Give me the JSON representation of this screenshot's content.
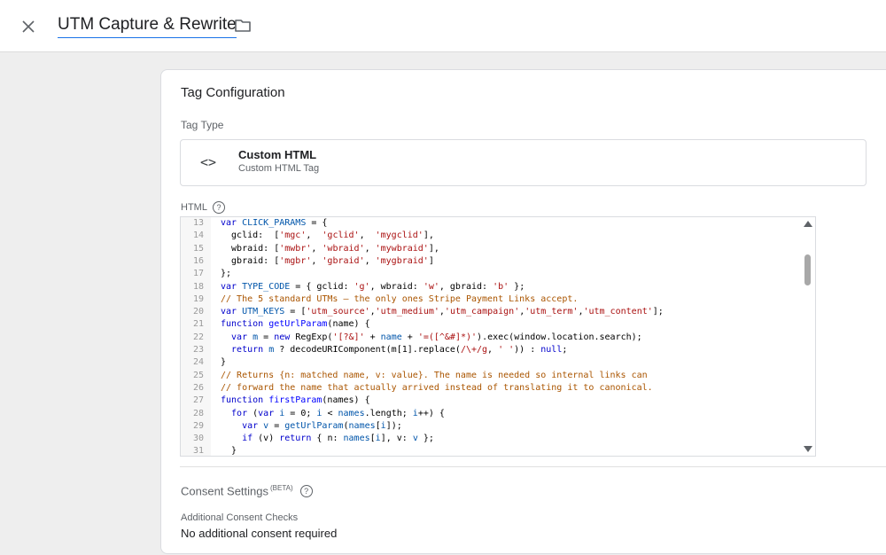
{
  "header": {
    "title": "UTM Capture & Rewrite",
    "close_icon": "close-icon",
    "folder_icon": "folder-icon"
  },
  "tag_config": {
    "title": "Tag Configuration",
    "tag_type_label": "Tag Type",
    "type_name": "Custom HTML",
    "type_sub": "Custom HTML Tag",
    "type_icon": "<>",
    "html_label": "HTML"
  },
  "code_lines": [
    {
      "n": "13",
      "parts": [
        [
          "k",
          "var "
        ],
        [
          "v",
          "CLICK_PARAMS"
        ],
        [
          "p",
          " = {"
        ]
      ]
    },
    {
      "n": "14",
      "parts": [
        [
          "p",
          "  gclid:  ["
        ],
        [
          "s",
          "'mgc'"
        ],
        [
          "p",
          ",  "
        ],
        [
          "s",
          "'gclid'"
        ],
        [
          "p",
          ",  "
        ],
        [
          "s",
          "'mygclid'"
        ],
        [
          "p",
          "],"
        ]
      ]
    },
    {
      "n": "15",
      "parts": [
        [
          "p",
          "  wbraid: ["
        ],
        [
          "s",
          "'mwbr'"
        ],
        [
          "p",
          ", "
        ],
        [
          "s",
          "'wbraid'"
        ],
        [
          "p",
          ", "
        ],
        [
          "s",
          "'mywbraid'"
        ],
        [
          "p",
          "],"
        ]
      ]
    },
    {
      "n": "16",
      "parts": [
        [
          "p",
          "  gbraid: ["
        ],
        [
          "s",
          "'mgbr'"
        ],
        [
          "p",
          ", "
        ],
        [
          "s",
          "'gbraid'"
        ],
        [
          "p",
          ", "
        ],
        [
          "s",
          "'mygbraid'"
        ],
        [
          "p",
          "]"
        ]
      ]
    },
    {
      "n": "17",
      "parts": [
        [
          "p",
          "};"
        ]
      ]
    },
    {
      "n": "18",
      "parts": [
        [
          "k",
          "var "
        ],
        [
          "v",
          "TYPE_CODE"
        ],
        [
          "p",
          " = { gclid: "
        ],
        [
          "s",
          "'g'"
        ],
        [
          "p",
          ", wbraid: "
        ],
        [
          "s",
          "'w'"
        ],
        [
          "p",
          ", gbraid: "
        ],
        [
          "s",
          "'b'"
        ],
        [
          "p",
          " };"
        ]
      ]
    },
    {
      "n": "19",
      "parts": [
        [
          "c",
          "// The 5 standard UTMs — the only ones Stripe Payment Links accept."
        ]
      ]
    },
    {
      "n": "20",
      "parts": [
        [
          "k",
          "var "
        ],
        [
          "v",
          "UTM_KEYS"
        ],
        [
          "p",
          " = ["
        ],
        [
          "s",
          "'utm_source'"
        ],
        [
          "p",
          ","
        ],
        [
          "s",
          "'utm_medium'"
        ],
        [
          "p",
          ","
        ],
        [
          "s",
          "'utm_campaign'"
        ],
        [
          "p",
          ","
        ],
        [
          "s",
          "'utm_term'"
        ],
        [
          "p",
          ","
        ],
        [
          "s",
          "'utm_content'"
        ],
        [
          "p",
          "];"
        ]
      ]
    },
    {
      "n": "21",
      "parts": [
        [
          "k",
          "function "
        ],
        [
          "f",
          "getUrlParam"
        ],
        [
          "p",
          "(name) {"
        ]
      ]
    },
    {
      "n": "22",
      "parts": [
        [
          "k",
          "  var "
        ],
        [
          "v",
          "m"
        ],
        [
          "p",
          " = "
        ],
        [
          "k",
          "new "
        ],
        [
          "p",
          "RegExp("
        ],
        [
          "s",
          "'[?&]'"
        ],
        [
          "p",
          " + "
        ],
        [
          "v",
          "name"
        ],
        [
          "p",
          " + "
        ],
        [
          "s",
          "'=([^&#]*)'"
        ],
        [
          "p",
          ").exec(window.location.search);"
        ]
      ]
    },
    {
      "n": "23",
      "parts": [
        [
          "k",
          "  return "
        ],
        [
          "v",
          "m"
        ],
        [
          "p",
          " ? decodeURIComponent(m[1].replace("
        ],
        [
          "s",
          "/\\+/g"
        ],
        [
          "p",
          ", "
        ],
        [
          "s",
          "' '"
        ],
        [
          "p",
          ")) : "
        ],
        [
          "k",
          "null"
        ],
        [
          "p",
          ";"
        ]
      ]
    },
    {
      "n": "24",
      "parts": [
        [
          "p",
          "}"
        ]
      ]
    },
    {
      "n": "25",
      "parts": [
        [
          "c",
          "// Returns {n: matched name, v: value}. The name is needed so internal links can"
        ]
      ]
    },
    {
      "n": "26",
      "parts": [
        [
          "c",
          "// forward the name that actually arrived instead of translating it to canonical."
        ]
      ]
    },
    {
      "n": "27",
      "parts": [
        [
          "k",
          "function "
        ],
        [
          "f",
          "firstParam"
        ],
        [
          "p",
          "(names) {"
        ]
      ]
    },
    {
      "n": "28",
      "parts": [
        [
          "k",
          "  for "
        ],
        [
          "p",
          "("
        ],
        [
          "k",
          "var "
        ],
        [
          "v",
          "i"
        ],
        [
          "p",
          " = 0; "
        ],
        [
          "v",
          "i"
        ],
        [
          "p",
          " < "
        ],
        [
          "v",
          "names"
        ],
        [
          "p",
          ".length; "
        ],
        [
          "v",
          "i"
        ],
        [
          "p",
          "++) {"
        ]
      ]
    },
    {
      "n": "29",
      "parts": [
        [
          "k",
          "    var "
        ],
        [
          "v",
          "v"
        ],
        [
          "p",
          " = "
        ],
        [
          "v",
          "getUrlParam"
        ],
        [
          "p",
          "("
        ],
        [
          "v",
          "names"
        ],
        [
          "p",
          "["
        ],
        [
          "v",
          "i"
        ],
        [
          "p",
          "]);"
        ]
      ]
    },
    {
      "n": "30",
      "parts": [
        [
          "k",
          "    if "
        ],
        [
          "p",
          "(v) "
        ],
        [
          "k",
          "return "
        ],
        [
          "p",
          "{ n: "
        ],
        [
          "v",
          "names"
        ],
        [
          "p",
          "["
        ],
        [
          "v",
          "i"
        ],
        [
          "p",
          "], v: "
        ],
        [
          "v",
          "v"
        ],
        [
          "p",
          " };"
        ]
      ]
    },
    {
      "n": "31",
      "parts": [
        [
          "p",
          "  }"
        ]
      ]
    }
  ],
  "consent": {
    "title": "Consent Settings",
    "beta": "(BETA)",
    "sub_label": "Additional Consent Checks",
    "value": "No additional consent required"
  }
}
